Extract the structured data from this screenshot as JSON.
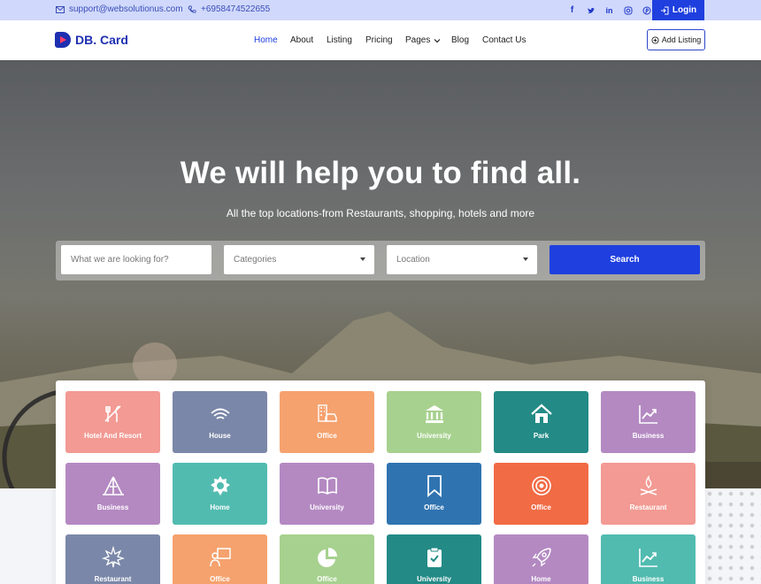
{
  "topbar": {
    "email": "support@websolutionus.com",
    "phone": "+6958474522655",
    "login_label": "Login",
    "social": [
      "facebook-icon",
      "twitter-icon",
      "linkedin-icon",
      "instagram-icon",
      "pinterest-icon"
    ]
  },
  "nav": {
    "logo_text": "DB. Card",
    "items": [
      "Home",
      "About",
      "Listing",
      "Pricing",
      "Pages",
      "Blog",
      "Contact Us"
    ],
    "active": "Home",
    "add_listing_label": "Add Listing"
  },
  "hero": {
    "title": "We will help you to find all.",
    "subtitle": "All the top locations-from Restaurants, shopping, hotels and more"
  },
  "search": {
    "query_placeholder": "What we are looking for?",
    "category_value": "Categories",
    "location_value": "Location",
    "button_label": "Search"
  },
  "categories": [
    {
      "label": "Hotel And Resort",
      "color": "#f29a93",
      "icon": "utensils-icon"
    },
    {
      "label": "House",
      "color": "#7a87a8",
      "icon": "wifi-icon"
    },
    {
      "label": "Office",
      "color": "#f5a26e",
      "icon": "office-car-icon"
    },
    {
      "label": "University",
      "color": "#a7d18f",
      "icon": "bank-icon"
    },
    {
      "label": "Park",
      "color": "#238a86",
      "icon": "home-icon"
    },
    {
      "label": "Business",
      "color": "#b489c2",
      "icon": "chart-icon"
    },
    {
      "label": "Business",
      "color": "#b489c2",
      "icon": "tent-icon"
    },
    {
      "label": "Home",
      "color": "#52bbb0",
      "icon": "badge-icon"
    },
    {
      "label": "University",
      "color": "#b489c2",
      "icon": "book-icon"
    },
    {
      "label": "Office",
      "color": "#2f73b0",
      "icon": "bookmark-icon"
    },
    {
      "label": "Office",
      "color": "#f16b45",
      "icon": "target-icon"
    },
    {
      "label": "Restaurant",
      "color": "#f29a93",
      "icon": "campfire-icon"
    },
    {
      "label": "Restaurant",
      "color": "#7a87a8",
      "icon": "leaf-icon"
    },
    {
      "label": "Office",
      "color": "#f5a26e",
      "icon": "presenter-icon"
    },
    {
      "label": "Office",
      "color": "#a7d18f",
      "icon": "pie-icon"
    },
    {
      "label": "University",
      "color": "#238a86",
      "icon": "clipboard-icon"
    },
    {
      "label": "Home",
      "color": "#b489c2",
      "icon": "rocket-icon"
    },
    {
      "label": "Business",
      "color": "#52bbb0",
      "icon": "chart-icon"
    }
  ]
}
